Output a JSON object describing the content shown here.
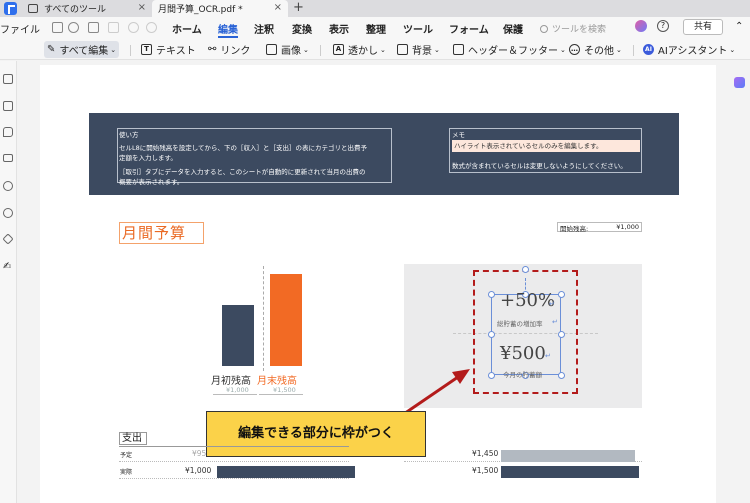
{
  "tabs": {
    "tools_label": "すべてのツール",
    "doc_label": "月間予算_OCR.pdf *",
    "close_icon": "×",
    "new_tab_icon": "+"
  },
  "menubar": {
    "file": "ファイル",
    "items": [
      "ホーム",
      "編集",
      "注釈",
      "変換",
      "表示",
      "整理",
      "ツール",
      "フォーム",
      "保護"
    ],
    "active": "編集",
    "search_placeholder": "ツールを検索",
    "help_icon": "?",
    "share": "共有"
  },
  "toolbar": {
    "edit_all": "すべて編集",
    "text": "テキスト",
    "link": "リンク",
    "image": "画像",
    "watermark": "透かし",
    "background": "背景",
    "header_footer": "ヘッダー＆フッター",
    "other": "その他",
    "ai": "AIアシスタント"
  },
  "document": {
    "usage": {
      "title": "使い方",
      "line1": "セルL8に開始残高を設定してから、下の［収入］と［支出］の表にカテゴリと出費予",
      "line2": "定額を入力します。",
      "line3": "［取引］タブにデータを入力すると、このシートが自動的に更新されて当月の出費の",
      "line4": "概要が表示されます。"
    },
    "memo": {
      "title": "メモ",
      "highlight": "ハイライト表示されているセルのみを編集します。",
      "note": "数式が含まれているセルは変更しないようにしてください。"
    },
    "budget_title": "月間予算",
    "start_balance_label": "開始残高:",
    "start_balance_value": "¥1,000",
    "chart_data": {
      "type": "bar",
      "categories": [
        "月初残高",
        "月末残高"
      ],
      "values": [
        1000,
        1500
      ],
      "value_labels": [
        "¥1,000",
        "¥1,500"
      ],
      "colors": [
        "#3c4a60",
        "#f26a24"
      ],
      "ylim": [
        0,
        1500
      ]
    },
    "savings": {
      "percent": "+50%",
      "percent_caption": "総貯蓄の増加率",
      "amount": "¥500",
      "amount_caption": "今月の貯蓄額"
    },
    "callout": "編集できる部分に枠がつく",
    "expenses": {
      "title": "支出",
      "rows": [
        {
          "label": "予定",
          "left_amount": "¥95",
          "right_amount": "¥1,450"
        },
        {
          "label": "実際",
          "left_amount": "¥1,000",
          "right_amount": "¥1,500"
        }
      ],
      "colors": {
        "planned": "#b2b9c1",
        "actual": "#3c4a60"
      }
    }
  }
}
